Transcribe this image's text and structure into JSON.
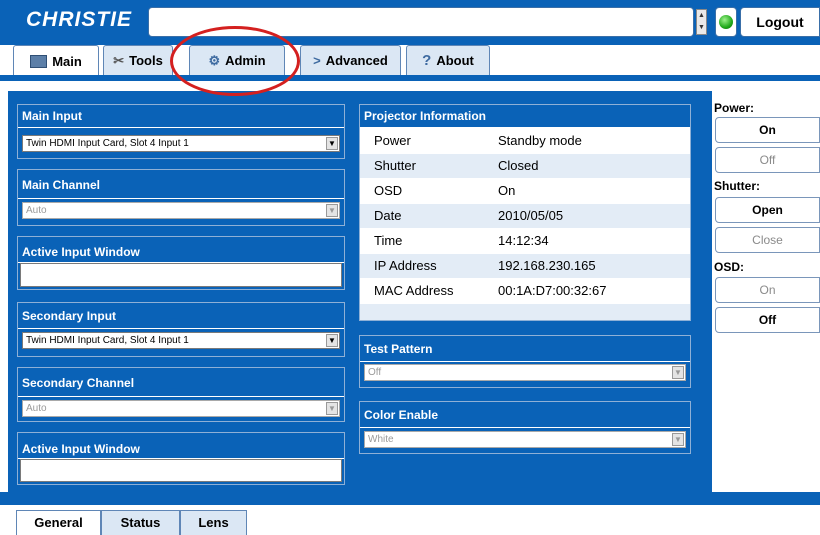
{
  "header": {
    "logo": "CHRISTIE",
    "logout_label": "Logout",
    "spin_up": "▲",
    "spin_down": "▼"
  },
  "tabs": [
    {
      "label": "Main",
      "icon": "monitor-icon",
      "active": true
    },
    {
      "label": "Tools",
      "icon": "tools-icon",
      "active": false
    },
    {
      "label": "Admin",
      "icon": "gear-icon",
      "active": false
    },
    {
      "label": "Advanced",
      "icon": "chevron-right-icon",
      "active": false
    },
    {
      "label": "About",
      "icon": "question-icon",
      "active": false
    }
  ],
  "left": {
    "main_input": {
      "title": "Main Input",
      "value": "Twin HDMI Input Card, Slot 4 Input 1"
    },
    "main_channel": {
      "title": "Main Channel",
      "value": "Auto"
    },
    "active_input_1": {
      "title": "Active Input Window"
    },
    "secondary_input": {
      "title": "Secondary Input",
      "value": "Twin HDMI Input Card, Slot 4 Input 1"
    },
    "secondary_channel": {
      "title": "Secondary Channel",
      "value": "Auto"
    },
    "active_input_2": {
      "title": "Active Input Window"
    }
  },
  "projector_info": {
    "title": "Projector Information",
    "rows": [
      {
        "key": "Power",
        "value": "Standby mode"
      },
      {
        "key": "Shutter",
        "value": "Closed"
      },
      {
        "key": "OSD",
        "value": "On"
      },
      {
        "key": "Date",
        "value": "2010/05/05"
      },
      {
        "key": "Time",
        "value": "14:12:34"
      },
      {
        "key": "IP Address",
        "value": "192.168.230.165"
      },
      {
        "key": "MAC Address",
        "value": "00:1A:D7:00:32:67"
      }
    ]
  },
  "test_pattern": {
    "title": "Test Pattern",
    "value": "Off"
  },
  "color_enable": {
    "title": "Color Enable",
    "value": "White"
  },
  "controls": {
    "power_label": "Power:",
    "power_on": "On",
    "power_off": "Off",
    "shutter_label": "Shutter:",
    "shutter_open": "Open",
    "shutter_close": "Close",
    "osd_label": "OSD:",
    "osd_on": "On",
    "osd_off": "Off"
  },
  "bottom_tabs": [
    {
      "label": "General",
      "active": true
    },
    {
      "label": "Status",
      "active": false
    },
    {
      "label": "Lens",
      "active": false
    }
  ],
  "colors": {
    "brand_blue": "#0a62b7",
    "annotation_red": "#d4201f",
    "status_green": "#1fa81a"
  }
}
